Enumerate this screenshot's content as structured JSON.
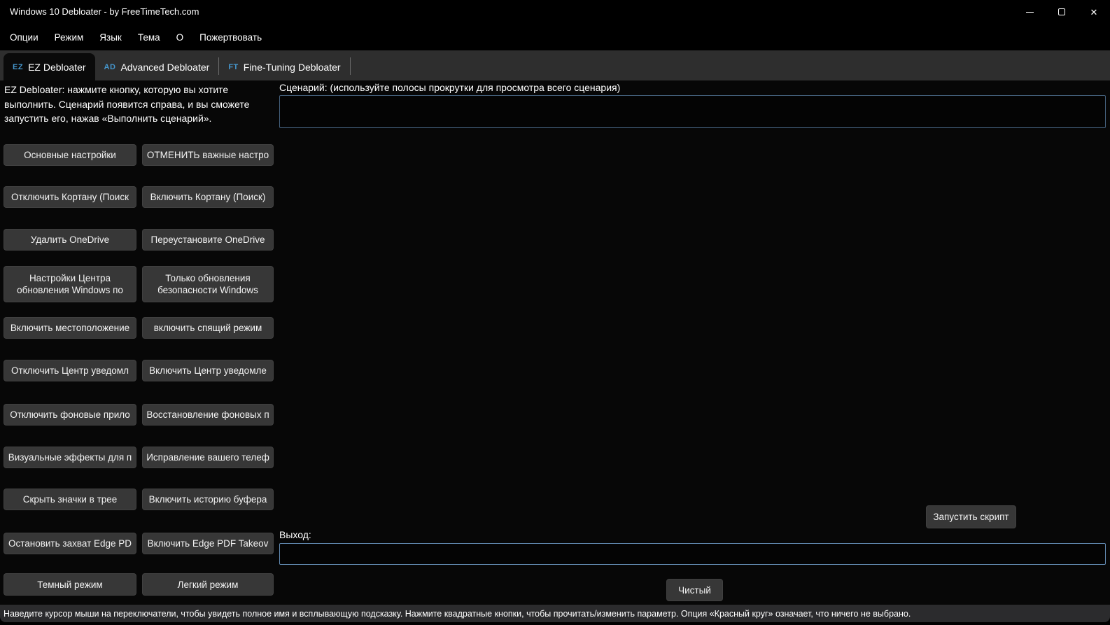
{
  "window": {
    "title": "Windows 10 Debloater - by FreeTimeTech.com",
    "controls": {
      "close_glyph": "✕"
    }
  },
  "menu": {
    "options": "Опции",
    "mode": "Режим",
    "language": "Язык",
    "theme": "Тема",
    "about": "О",
    "donate": "Пожертвовать"
  },
  "tabs": [
    {
      "badge": "EZ",
      "label": "EZ Debloater",
      "active": true
    },
    {
      "badge": "AD",
      "label": "Advanced Debloater",
      "active": false
    },
    {
      "badge": "FT",
      "label": "Fine-Tuning Debloater",
      "active": false
    }
  ],
  "left_panel": {
    "description": "EZ Debloater: нажмите кнопку, которую вы хотите выполнить. Сценарий появится справа, и вы сможете запустить его, нажав «Выполнить сценарий».",
    "rows": [
      {
        "l": "Основные настройки",
        "r": "ОТМЕНИТЬ важные настро"
      },
      {
        "l": "Отключить Кортану (Поиск",
        "r": "Включить Кортану (Поиск)"
      },
      {
        "l": "Удалить OneDrive",
        "r": "Переустановите OneDrive"
      },
      {
        "l": "Настройки Центра обновления Windows по",
        "r": "Только обновления безопасности Windows"
      },
      {
        "l": "Включить местоположение",
        "r": "включить спящий режим"
      },
      {
        "l": "Отключить Центр уведомл",
        "r": "Включить Центр уведомле"
      },
      {
        "l": "Отключить фоновые прило",
        "r": "Восстановление фоновых п"
      },
      {
        "l": "Визуальные эффекты для п",
        "r": "Исправление вашего телеф"
      },
      {
        "l": "Скрыть значки в трее",
        "r": "Включить историю буфера"
      },
      {
        "l": "Остановить захват Edge PD",
        "r": "Включить Edge PDF Takeov"
      },
      {
        "l": "Темный режим",
        "r": "Легкий режим"
      }
    ]
  },
  "right_panel": {
    "script_label": "Сценарий: (используйте полосы прокрутки для просмотра всего сценария)",
    "script_value": "",
    "run_button": "Запустить скрипт",
    "output_label": "Выход:",
    "output_value": "",
    "clear_button": "Чистый"
  },
  "status_bar": {
    "text": "Наведите курсор мыши на переключатели, чтобы увидеть полное имя и всплывающую подсказку. Нажмите квадратные кнопки, чтобы прочитать/изменить параметр. Опция «Красный круг» означает, что ничего не выбрано."
  },
  "colors": {
    "accent_blue": "#4596cc",
    "script_border": "#44607c",
    "output_border": "#6189b0",
    "button_bg": "#373737",
    "tabstrip_bg": "#2e2e2e",
    "statusbar_bg": "#2b2b2d"
  }
}
